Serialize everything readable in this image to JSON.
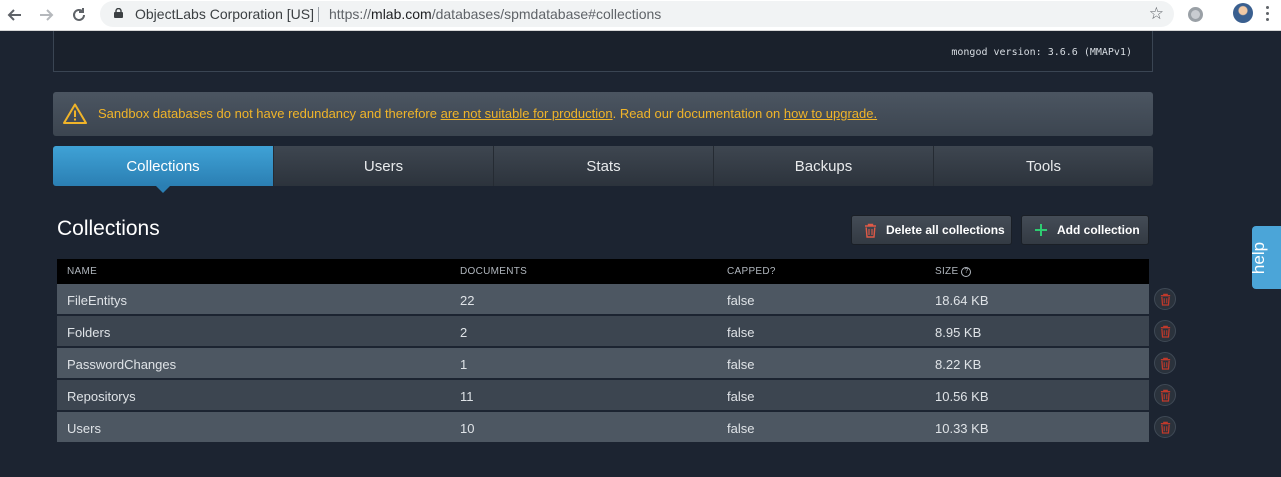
{
  "browser": {
    "org": "ObjectLabs Corporation [US]",
    "url_prefix": "https://",
    "url_host": "mlab.com",
    "url_path": "/databases/spmdatabase#collections"
  },
  "server": {
    "mongod_version": "mongod version: 3.6.6 (MMAPv1)"
  },
  "alert": {
    "text_before": "Sandbox databases do not have redundancy and therefore ",
    "link1": "are not suitable for production",
    "text_middle": ". Read our documentation on ",
    "link2": "how to upgrade."
  },
  "tabs": [
    {
      "label": "Collections"
    },
    {
      "label": "Users"
    },
    {
      "label": "Stats"
    },
    {
      "label": "Backups"
    },
    {
      "label": "Tools"
    }
  ],
  "collections": {
    "title": "Collections",
    "delete_all_label": "Delete all collections",
    "add_label": "Add collection",
    "columns": {
      "name": "NAME",
      "documents": "DOCUMENTS",
      "capped": "CAPPED?",
      "size": "SIZE"
    },
    "size_help_glyph": "?",
    "rows": [
      {
        "name": "FileEntitys",
        "documents": "22",
        "capped": "false",
        "size": "18.64 KB"
      },
      {
        "name": "Folders",
        "documents": "2",
        "capped": "false",
        "size": "8.95 KB"
      },
      {
        "name": "PasswordChanges",
        "documents": "1",
        "capped": "false",
        "size": "8.22 KB"
      },
      {
        "name": "Repositorys",
        "documents": "11",
        "capped": "false",
        "size": "10.56 KB"
      },
      {
        "name": "Users",
        "documents": "10",
        "capped": "false",
        "size": "10.33 KB"
      }
    ]
  },
  "help_tab": {
    "label": "help"
  },
  "colors": {
    "page_bg": "#1c2431",
    "active_tab": "#3fa2d6",
    "warning": "#f0b429",
    "danger": "#c0392b",
    "add_green": "#2ecc71",
    "help_blue": "#4ba5d8"
  },
  "icons": [
    "back-arrow-icon",
    "forward-arrow-icon",
    "reload-icon",
    "lock-icon",
    "star-icon",
    "extension-icon",
    "warning-icon",
    "trash-icon",
    "plus-icon",
    "help-circle-icon"
  ]
}
